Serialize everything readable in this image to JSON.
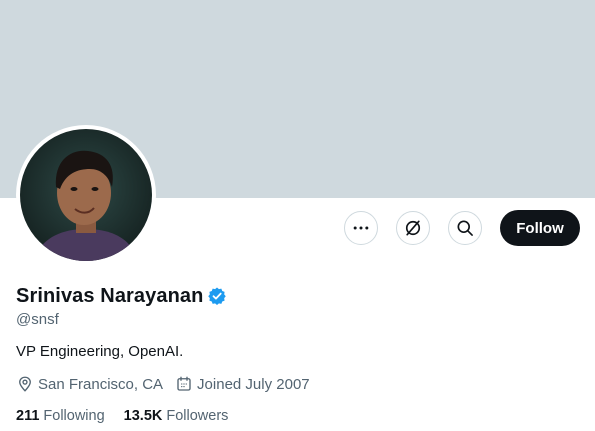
{
  "colors": {
    "banner": "#cfd9de",
    "text_primary": "#0f1419",
    "text_secondary": "#536471",
    "follow_bg": "#0f1419",
    "verified": "#1d9bf0",
    "button_border": "#cfd9de"
  },
  "profile": {
    "display_name": "Srinivas Narayanan",
    "handle": "@snsf",
    "verified": true,
    "bio": "VP Engineering, OpenAI.",
    "location": "San Francisco, CA",
    "joined": "Joined July 2007",
    "avatar_icon": "profile-photo"
  },
  "actions": {
    "more_icon": "more-icon",
    "grok_icon": "grok-icon",
    "search_icon": "search-icon",
    "follow_label": "Follow"
  },
  "stats": {
    "following_count": "211",
    "following_label": "Following",
    "followers_count": "13.5K",
    "followers_label": "Followers"
  }
}
